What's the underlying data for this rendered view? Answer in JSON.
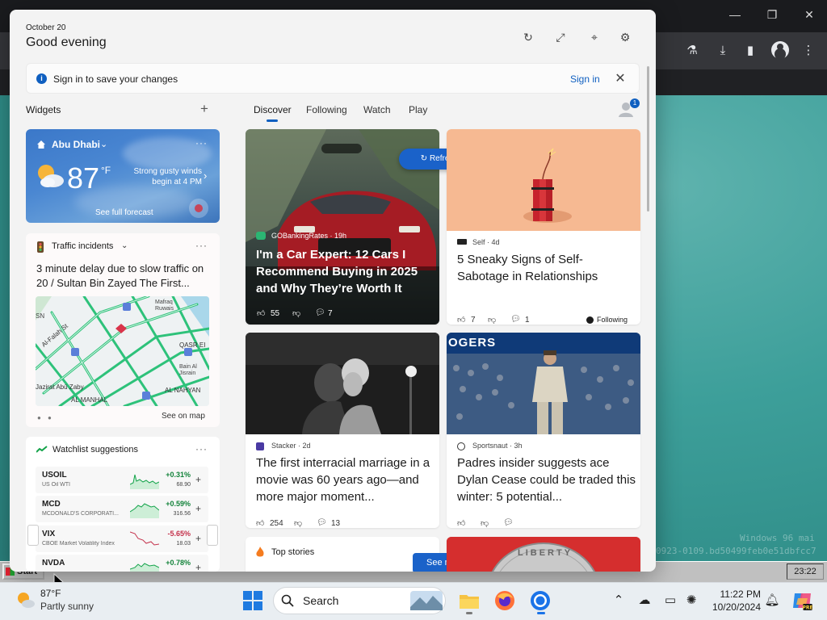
{
  "background": {
    "terminal_line1": "Windows 96 mai",
    "terminal_line2": "0923-0109.bd50499feb0e51dbfcc7"
  },
  "legacy_taskbar": {
    "start_label": "Start",
    "clock": "23:22"
  },
  "panel": {
    "date": "October 20",
    "greeting": "Good evening",
    "header_icons": [
      "refresh-icon",
      "expand-icon",
      "pin-icon",
      "settings-icon"
    ]
  },
  "signin_bar": {
    "message": "Sign in to save your changes",
    "button": "Sign in"
  },
  "widgets_header": {
    "label": "Widgets",
    "add": "+"
  },
  "feed_tabs": [
    {
      "label": "Discover",
      "active": true
    },
    {
      "label": "Following",
      "active": false
    },
    {
      "label": "Watch",
      "active": false
    },
    {
      "label": "Play",
      "active": false
    }
  ],
  "profile_badge": "1",
  "weather": {
    "location": "Abu Dhabi",
    "temperature": "87",
    "unit": "°F",
    "description": "Strong gusty winds begin at 4 PM",
    "forecast_link": "See full forecast",
    "more": "···"
  },
  "traffic": {
    "title": "Traffic incidents",
    "text": "3 minute delay due to slow traffic on 20 / Sultan Bin Zayed The First...",
    "see_on_map": "See on map",
    "more": "···",
    "map_labels": [
      "SN",
      "Mafraq Ruwais",
      "Al-Falah St",
      "QASR EI",
      "Bain Al Jisrain",
      "AL NAHYAN",
      "Jazirat Abū Zaby",
      "AL MANHAL"
    ]
  },
  "watchlist": {
    "title": "Watchlist suggestions",
    "more": "···",
    "stocks": [
      {
        "symbol": "USOIL",
        "name": "US Oil WTI",
        "change": "+0.31%",
        "price": "68.90",
        "positive": true
      },
      {
        "symbol": "MCD",
        "name": "MCDONALD'S CORPORATI...",
        "change": "+0.59%",
        "price": "316.56",
        "positive": true
      },
      {
        "symbol": "VIX",
        "name": "CBOE Market Volatility Index",
        "change": "-5.65%",
        "price": "18.03",
        "positive": false
      },
      {
        "symbol": "NVDA",
        "name": "",
        "change": "+0.78%",
        "price": "",
        "positive": true
      }
    ]
  },
  "refresh_pill": "Refresh stories",
  "news": [
    {
      "source": "GOBankingRates",
      "age": "19h",
      "title": "I'm a Car Expert: 12 Cars I Recommend Buying in 2025 and Why They’re Worth It",
      "likes": "55",
      "comments": "7"
    },
    {
      "source": "Self",
      "age": "4d",
      "title": "5 Sneaky Signs of Self-Sabotage in Relationships",
      "likes": "7",
      "comments": "1",
      "following": "Following"
    },
    {
      "source": "Stacker",
      "age": "2d",
      "title": "The first interracial marriage in a movie was 60 years ago—and more major moment...",
      "likes": "254",
      "comments": "13"
    },
    {
      "source": "Sportsnaut",
      "age": "3h",
      "title": "Padres insider suggests ace Dylan Cease could be traded this winter: 5 potential...",
      "likes": "",
      "comments": ""
    }
  ],
  "top_stories": {
    "title": "Top stories",
    "see_more": "See more"
  },
  "image_text": {
    "dodgers_banner": "OGERS",
    "coin_text": "LIBERTY"
  },
  "taskbar": {
    "weather_temp": "87°F",
    "weather_condition": "Partly sunny",
    "search_label": "Search",
    "time": "11:22 PM",
    "date": "10/20/2024"
  },
  "colors": {
    "accent": "#0f5fc0",
    "positive": "#13833a",
    "negative": "#c4314b",
    "panel_bg": "#f3f3f3"
  }
}
